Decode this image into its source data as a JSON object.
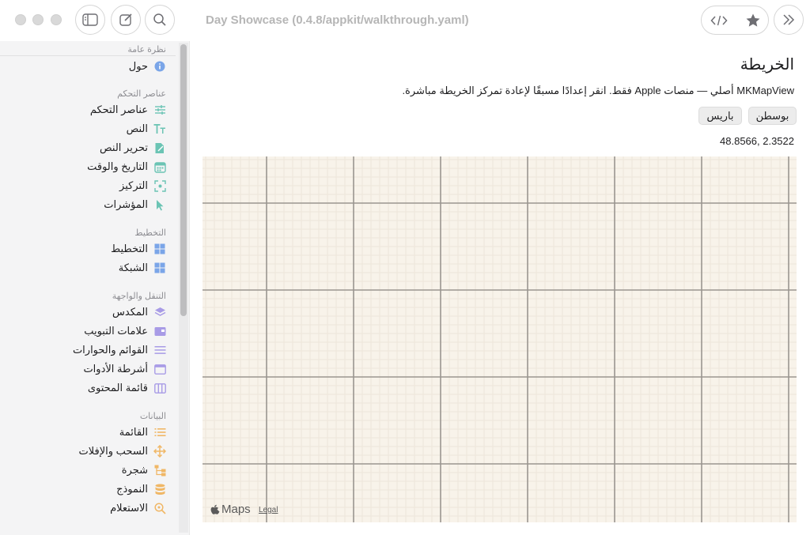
{
  "window": {
    "title": "Day Showcase (0.4.8/appkit/walkthrough.yaml)"
  },
  "toolbar": {
    "sidebar_toggle_icon": "sidebar-icon",
    "compose_icon": "compose-icon",
    "search_icon": "search-icon",
    "code_icon": "code-icon",
    "star_icon": "star-icon",
    "forward_icon": "chevron-double-right-icon"
  },
  "sidebar": {
    "sections": [
      {
        "title": "نظرة عامة",
        "items": [
          {
            "label": "حول",
            "icon": "info-icon",
            "color": "#7aa5e8"
          }
        ]
      },
      {
        "title": "عناصر التحكم",
        "items": [
          {
            "label": "عناصر التحكم",
            "icon": "sliders-icon",
            "color": "#6bc4b4"
          },
          {
            "label": "النص",
            "icon": "text-icon",
            "color": "#6bc4b4"
          },
          {
            "label": "تحرير النص",
            "icon": "edit-doc-icon",
            "color": "#6bc4b4"
          },
          {
            "label": "التاريخ والوقت",
            "icon": "calendar-icon",
            "color": "#6bc4b4"
          },
          {
            "label": "التركيز",
            "icon": "focus-icon",
            "color": "#6bc4b4"
          },
          {
            "label": "المؤشرات",
            "icon": "cursor-icon",
            "color": "#6bc4b4"
          }
        ]
      },
      {
        "title": "التخطيط",
        "items": [
          {
            "label": "التخطيط",
            "icon": "layout-icon",
            "color": "#7aa5e8"
          },
          {
            "label": "الشبكة",
            "icon": "grid-icon",
            "color": "#7aa5e8"
          }
        ]
      },
      {
        "title": "التنقل والواجهة",
        "items": [
          {
            "label": "المكدس",
            "icon": "stack-icon",
            "color": "#a89be6"
          },
          {
            "label": "علامات التبويب",
            "icon": "tabs-icon",
            "color": "#a89be6"
          },
          {
            "label": "القوائم والحوارات",
            "icon": "menu-icon",
            "color": "#a89be6"
          },
          {
            "label": "أشرطة الأدوات",
            "icon": "toolbar-icon",
            "color": "#a89be6"
          },
          {
            "label": "قائمة المحتوى",
            "icon": "columns-icon",
            "color": "#a89be6"
          }
        ]
      },
      {
        "title": "البيانات",
        "items": [
          {
            "label": "القائمة",
            "icon": "list-icon",
            "color": "#f0b766"
          },
          {
            "label": "السحب والإفلات",
            "icon": "move-icon",
            "color": "#f0b766"
          },
          {
            "label": "شجرة",
            "icon": "tree-icon",
            "color": "#f0b766"
          },
          {
            "label": "النموذج",
            "icon": "database-icon",
            "color": "#f0b766"
          },
          {
            "label": "الاستعلام",
            "icon": "query-icon",
            "color": "#f0b766"
          }
        ]
      }
    ]
  },
  "main": {
    "title": "الخريطة",
    "description": "MKMapView أصلي — منصات Apple فقط. انقر إعدادًا مسبقًا لإعادة تمركز الخريطة مباشرة.",
    "presets": [
      {
        "label": "بوسطن"
      },
      {
        "label": "باريس"
      }
    ],
    "coordinates": "48.8566, 2.3522",
    "map": {
      "logo_text": "Maps",
      "legal_text": "Legal"
    }
  }
}
